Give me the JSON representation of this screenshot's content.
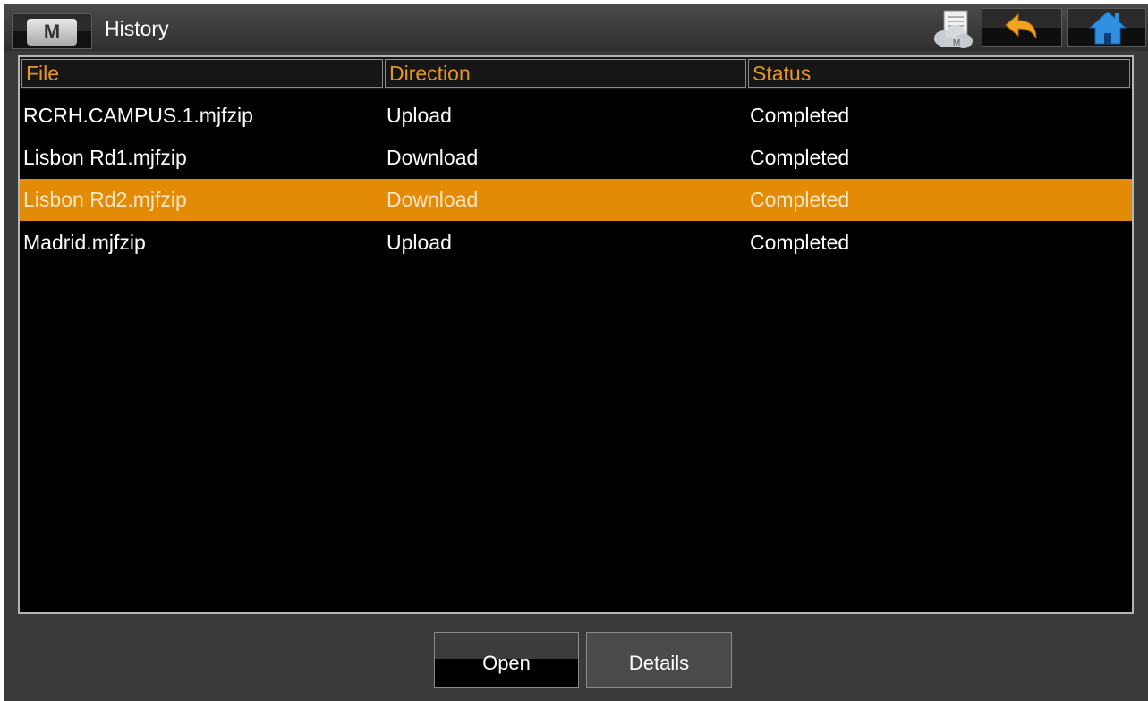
{
  "window": {
    "title": "History",
    "logo_letter": "M",
    "cloud_badge_letter": "M"
  },
  "toolbar": {
    "buttons": [
      {
        "name": "cloud-document-button",
        "icon": "cloud-document-icon"
      },
      {
        "name": "back-button",
        "icon": "back-arrow-icon"
      },
      {
        "name": "home-button",
        "icon": "home-icon"
      }
    ]
  },
  "table": {
    "columns": [
      "File",
      "Direction",
      "Status"
    ],
    "rows": [
      {
        "file": "RCRH.CAMPUS.1.mjfzip",
        "direction": "Upload",
        "status": "Completed",
        "selected": false
      },
      {
        "file": "Lisbon Rd1.mjfzip",
        "direction": "Download",
        "status": "Completed",
        "selected": false
      },
      {
        "file": "Lisbon Rd2.mjfzip",
        "direction": "Download",
        "status": "Completed",
        "selected": true
      },
      {
        "file": "Madrid.mjfzip",
        "direction": "Upload",
        "status": "Completed",
        "selected": false
      }
    ]
  },
  "actions": {
    "open_label": "Open",
    "details_label": "Details"
  },
  "colors": {
    "accent": "#e38b06",
    "header_text": "#e8961f",
    "background": "#000000",
    "chrome": "#3a3a3a"
  }
}
